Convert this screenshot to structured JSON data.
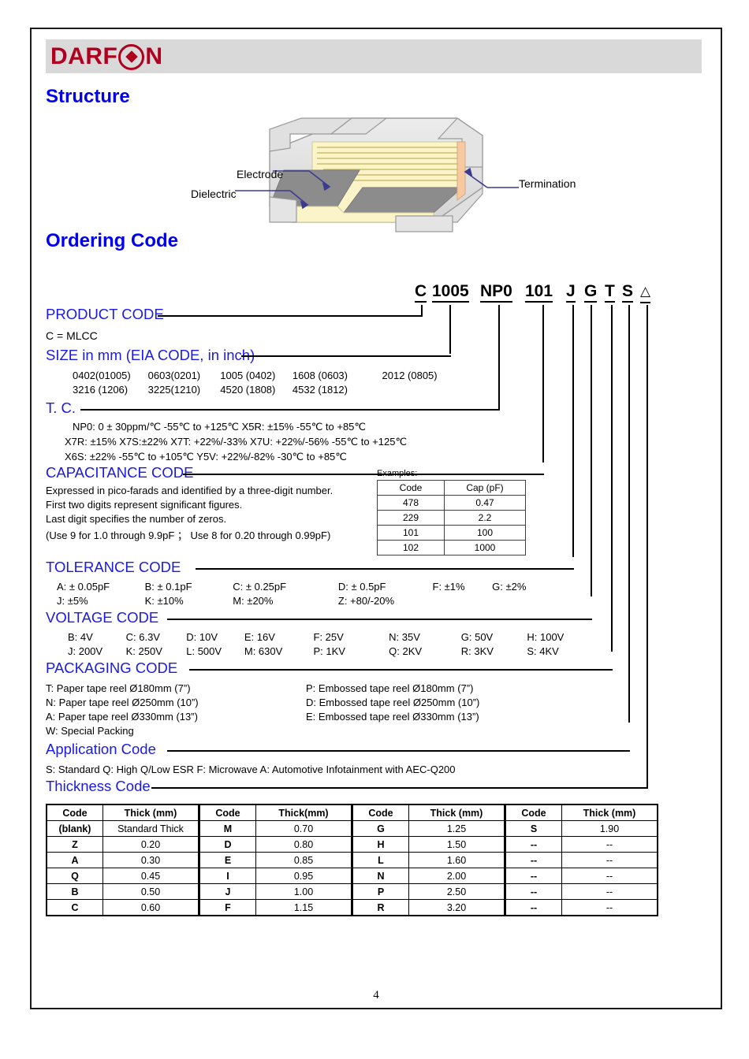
{
  "brand": {
    "name_before": "DARF",
    "name_after": "N",
    "logo_icon": "diamond-in-circle-icon"
  },
  "sections": {
    "structure_title": "Structure",
    "ordering_title": "Ordering Code"
  },
  "diagram": {
    "label_electrode": "Electrode",
    "label_dielectric": "Dielectric",
    "label_termination": "Termination"
  },
  "ordering_code": {
    "segments": [
      "C",
      "1005",
      "NP0",
      "101",
      "J",
      "G",
      "T",
      "S"
    ],
    "suffix": "△"
  },
  "product_code": {
    "heading": "PRODUCT CODE",
    "lines": [
      "C  =  MLCC"
    ]
  },
  "size_code": {
    "heading": "SIZE in mm (EIA CODE, in inch)",
    "row1": [
      "0402(01005)",
      "0603(0201)",
      "1005 (0402)",
      "1608 (0603)",
      "2012 (0805)"
    ],
    "row2": [
      "3216 (1206)",
      "3225(1210)",
      "4520 (1808)",
      "4532 (1812)"
    ]
  },
  "tc_code": {
    "heading": "T. C.",
    "line1": "NP0: 0 ± 30ppm/℃   -55℃  to +125℃        X5R: ±15%    -55℃  to +85℃",
    "line2": "X7R: ±15%   X7S:±22%   X7T: +22%/-33%   X7U: +22%/-56%    -55℃  to +125℃",
    "line3": "X6S: ±22%     -55℃  to +105℃        Y5V: +22%/-82%     -30℃ to +85℃"
  },
  "capacitance_code": {
    "heading": "CAPACITANCE CODE",
    "line1": "Expressed in pico-farads and identified by a three-digit number.",
    "line2": "First two digits represent significant figures.",
    "line3": "Last digit specifies the number of zeros.",
    "line4": "(Use 9 for 1.0 through 9.9pF ；  Use 8 for 0.20 through 0.99pF)",
    "examples_caption": "Examples:",
    "examples_headers": [
      "Code",
      "Cap (pF)"
    ],
    "examples_rows": [
      [
        "478",
        "0.47"
      ],
      [
        "229",
        "2.2"
      ],
      [
        "101",
        "100"
      ],
      [
        "102",
        "1000"
      ]
    ]
  },
  "tolerance_code": {
    "heading": "TOLERANCE CODE",
    "row1": [
      "A: ± 0.05pF",
      "B: ± 0.1pF",
      "C: ± 0.25pF",
      "D: ± 0.5pF",
      "F: ±1%",
      "G: ±2%"
    ],
    "row2": [
      "J: ±5%",
      "K: ±10%",
      "M: ±20%",
      "Z: +80/-20%"
    ]
  },
  "voltage_code": {
    "heading": "VOLTAGE CODE",
    "row1": [
      "B: 4V",
      "C: 6.3V",
      "D: 10V",
      "E: 16V",
      "F: 25V",
      "N: 35V",
      "G: 50V",
      "H: 100V"
    ],
    "row2": [
      "J: 200V",
      "K: 250V",
      "L: 500V",
      "M: 630V",
      "P: 1KV",
      "Q: 2KV",
      "R: 3KV",
      "S: 4KV"
    ]
  },
  "packaging_code": {
    "heading": "PACKAGING CODE",
    "left": [
      "T: Paper tape reel Ø180mm (7”)",
      "N: Paper tape reel Ø250mm (10”)",
      "A: Paper tape reel Ø330mm (13”)",
      "W: Special Packing"
    ],
    "right": [
      "P: Embossed tape reel Ø180mm (7”)",
      "D: Embossed tape reel Ø250mm (10”)",
      "E: Embossed tape reel Ø330mm (13”)"
    ]
  },
  "application_code": {
    "heading": "Application Code",
    "line1": "S: Standard   Q: High Q/Low ESR  F: Microwave A: Automotive Infotainment with AEC-Q200"
  },
  "thickness_code": {
    "heading": "Thickness Code",
    "headers": [
      "Code",
      "Thick (mm)",
      "Code",
      "Thick(mm)",
      "Code",
      "Thick (mm)",
      "Code",
      "Thick (mm)"
    ],
    "rows": [
      [
        "(blank)",
        "Standard Thick",
        "M",
        "0.70",
        "G",
        "1.25",
        "S",
        "1.90"
      ],
      [
        "Z",
        "0.20",
        "D",
        "0.80",
        "H",
        "1.50",
        "--",
        "--"
      ],
      [
        "A",
        "0.30",
        "E",
        "0.85",
        "L",
        "1.60",
        "--",
        "--"
      ],
      [
        "Q",
        "0.45",
        "I",
        "0.95",
        "N",
        "2.00",
        "--",
        "--"
      ],
      [
        "B",
        "0.50",
        "J",
        "1.00",
        "P",
        "2.50",
        "--",
        "--"
      ],
      [
        "C",
        "0.60",
        "F",
        "1.15",
        "R",
        "3.20",
        "--",
        "--"
      ]
    ]
  },
  "footer": {
    "page_number": "4"
  },
  "colors": {
    "brand_red": "#b00020",
    "heading_blue": "#0000ee",
    "code_blue": "#1a1ae6",
    "header_gray": "#d9d9d9"
  }
}
